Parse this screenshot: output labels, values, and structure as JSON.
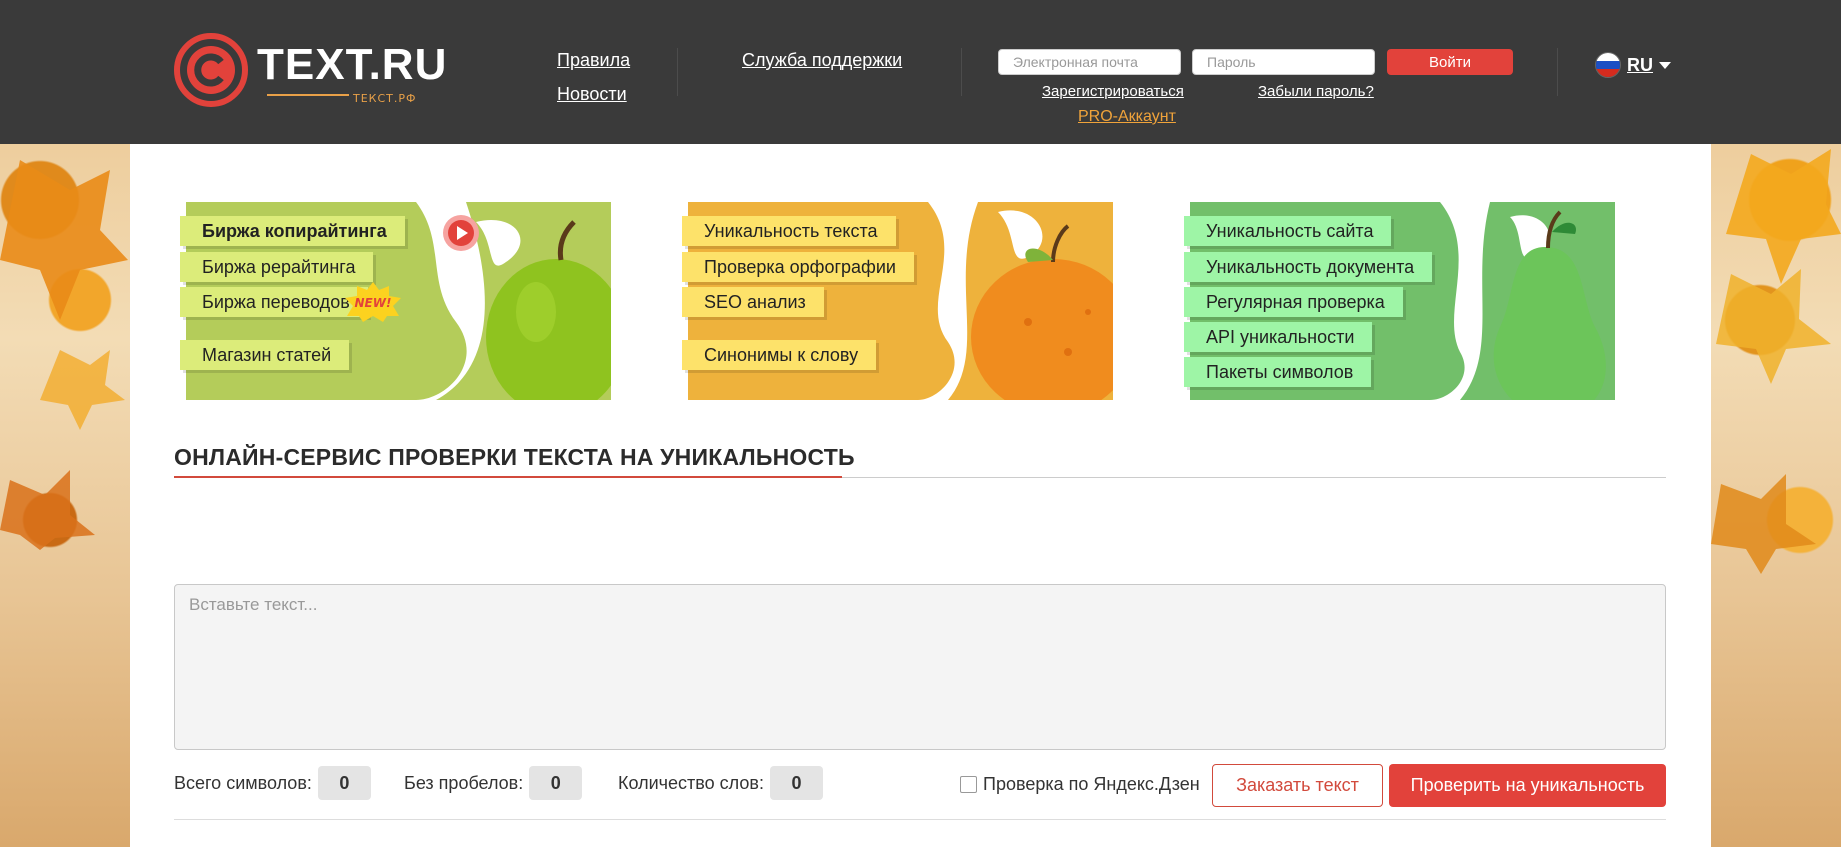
{
  "header": {
    "logo_text": "TEXT.RU",
    "logo_sub": "ТЕКСТ.РФ",
    "nav": {
      "rules": "Правила",
      "news": "Новости",
      "support": "Служба поддержки"
    },
    "login": {
      "email_placeholder": "Электронная почта",
      "password_placeholder": "Пароль",
      "submit": "Войти",
      "register": "Зарегистрироваться",
      "forgot": "Забыли пароль?",
      "pro": "PRO-Аккаунт"
    },
    "lang": "RU"
  },
  "banners": {
    "exchange": {
      "items": [
        "Биржа копирайтинга",
        "Биржа рерайтинга",
        "Биржа переводов",
        "Магазин статей"
      ],
      "new_badge": "NEW!"
    },
    "tools": {
      "items": [
        "Уникальность текста",
        "Проверка орфографии",
        "SEO анализ",
        "Синонимы к слову"
      ]
    },
    "services": {
      "items": [
        "Уникальность сайта",
        "Уникальность документа",
        "Регулярная проверка",
        "API уникальности",
        "Пакеты символов"
      ]
    }
  },
  "main": {
    "title": "ОНЛАЙН-СЕРВИС ПРОВЕРКИ ТЕКСТА НА УНИКАЛЬНОСТЬ",
    "textarea_placeholder": "Вставьте текст...",
    "counters": {
      "total_label": "Всего символов:",
      "total_value": "0",
      "nospace_label": "Без пробелов:",
      "nospace_value": "0",
      "words_label": "Количество слов:",
      "words_value": "0"
    },
    "yandex_check": "Проверка по Яндекс.Дзен",
    "order_button": "Заказать текст",
    "check_button": "Проверить на уникальность"
  },
  "colors": {
    "header_bg": "#3a3a3a",
    "accent_red": "#e2423b",
    "pro_orange": "#f0a33a",
    "banner_green": "#b4cc5a",
    "banner_orange": "#eeb23c",
    "banner_mint": "#72bf6a"
  }
}
